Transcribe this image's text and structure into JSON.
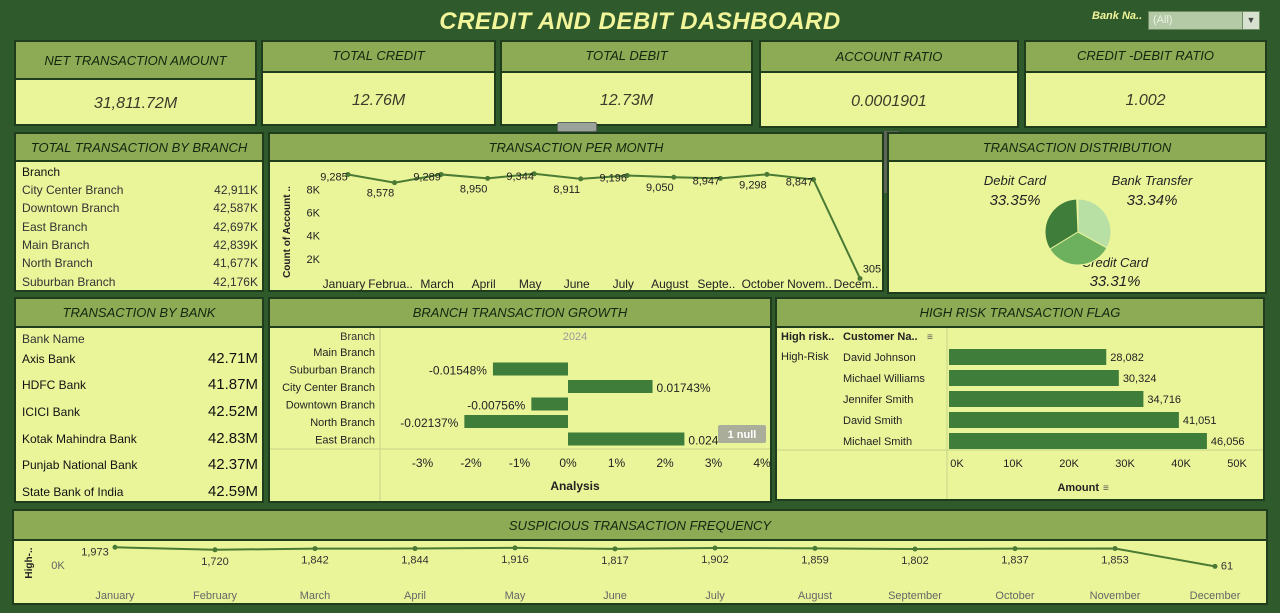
{
  "dashboard": {
    "title": "CREDIT AND DEBIT DASHBOARD"
  },
  "filter": {
    "label": "Bank Na..",
    "value": "(All)"
  },
  "kpis": [
    {
      "title": "NET TRANSACTION AMOUNT",
      "value": "31,811.72M"
    },
    {
      "title": "TOTAL CREDIT",
      "value": "12.76M"
    },
    {
      "title": "TOTAL DEBIT",
      "value": "12.73M"
    },
    {
      "title": "ACCOUNT RATIO",
      "value": "0.0001901"
    },
    {
      "title": "CREDIT -DEBIT RATIO",
      "value": "1.002"
    }
  ],
  "branch_panel": {
    "title": "TOTAL TRANSACTION BY BRANCH",
    "header": "Branch",
    "rows": [
      {
        "name": "City Center Branch",
        "value": "42,911K"
      },
      {
        "name": "Downtown Branch",
        "value": "42,587K"
      },
      {
        "name": "East Branch",
        "value": "42,697K"
      },
      {
        "name": "Main Branch",
        "value": "42,839K"
      },
      {
        "name": "North Branch",
        "value": "41,677K"
      },
      {
        "name": "Suburban Branch",
        "value": "42,176K"
      }
    ]
  },
  "bank_panel": {
    "title": "TRANSACTION BY BANK",
    "header": "Bank Name",
    "rows": [
      {
        "name": "Axis Bank",
        "value": "42.71M"
      },
      {
        "name": "HDFC Bank",
        "value": "41.87M"
      },
      {
        "name": "ICICI Bank",
        "value": "42.52M"
      },
      {
        "name": "Kotak Mahindra Bank",
        "value": "42.83M"
      },
      {
        "name": "Punjab National Bank",
        "value": "42.37M"
      },
      {
        "name": "State Bank of India",
        "value": "42.59M"
      }
    ]
  },
  "chart_data": [
    {
      "id": "monthly",
      "title": "TRANSACTION PER MONTH",
      "type": "line",
      "ylabel": "Count of Account ..",
      "categories": [
        "January",
        "Februa..",
        "March",
        "April",
        "May",
        "June",
        "July",
        "August",
        "Septe..",
        "October",
        "Novem..",
        "Decem.."
      ],
      "values": [
        9285,
        8578,
        9289,
        8950,
        9344,
        8911,
        9196,
        9050,
        8947,
        9298,
        8847,
        305
      ],
      "labels": [
        "9,285",
        "8,578",
        "9,289",
        "8,950",
        "9,344",
        "8,911",
        "9,196",
        "9,050",
        "8,947",
        "9,298",
        "8,847",
        "305"
      ],
      "yticks": [
        "2K",
        "4K",
        "6K",
        "8K"
      ],
      "ylim": [
        0,
        9500
      ],
      "color": "#4a7a34"
    },
    {
      "id": "distribution",
      "title": "TRANSACTION DISTRIBUTION",
      "type": "pie",
      "slices": [
        {
          "name": "Debit Card",
          "pct": "33.35%",
          "value": 33.35,
          "color": "#3f7d3a"
        },
        {
          "name": "Bank Transfer",
          "pct": "33.34%",
          "value": 33.34,
          "color": "#b9e0a4"
        },
        {
          "name": "Credit Card",
          "pct": "33.31%",
          "value": 33.31,
          "color": "#6db05d"
        }
      ]
    },
    {
      "id": "growth",
      "title": "BRANCH TRANSACTION GROWTH",
      "type": "bar",
      "header": "Branch",
      "column": "2024",
      "xlabel": "Analysis",
      "categories": [
        "Main Branch",
        "Suburban Branch",
        "City Center Branch",
        "Downtown Branch",
        "North Branch",
        "East Branch"
      ],
      "values": [
        null,
        -1.548,
        1.743,
        -0.756,
        -2.137,
        2.4
      ],
      "labels": [
        "",
        "-0.01548%",
        "0.01743%",
        "-0.00756%",
        "-0.02137%",
        "0.024"
      ],
      "xticks": [
        "-3%",
        "-2%",
        "-1%",
        "0%",
        "1%",
        "2%",
        "3%",
        "4%"
      ],
      "xlim": [
        -4,
        4
      ],
      "null_badge": "1 null",
      "color": "#3f7d3a"
    },
    {
      "id": "highrisk",
      "title": "HIGH RISK TRANSACTION FLAG",
      "type": "bar",
      "col1": "High risk..",
      "col2": "Customer Na..",
      "group": "High-Risk",
      "xlabel": "Amount",
      "categories": [
        "David Johnson",
        "Michael Williams",
        "Jennifer Smith",
        "David Smith",
        "Michael Smith"
      ],
      "values": [
        28082,
        30324,
        34716,
        41051,
        46056
      ],
      "labels": [
        "28,082",
        "30,324",
        "34,716",
        "41,051",
        "46,056"
      ],
      "xticks": [
        "0K",
        "10K",
        "20K",
        "30K",
        "40K",
        "50K"
      ],
      "xlim": [
        0,
        50000
      ],
      "color": "#3f7d3a"
    },
    {
      "id": "suspicious",
      "title": "SUSPICIOUS TRANSACTION FREQUENCY",
      "type": "line",
      "ylabel": "High-..",
      "ytick": "0K",
      "categories": [
        "January",
        "February",
        "March",
        "April",
        "May",
        "June",
        "July",
        "August",
        "September",
        "October",
        "November",
        "December"
      ],
      "values": [
        1973,
        1720,
        1842,
        1844,
        1916,
        1817,
        1902,
        1859,
        1802,
        1837,
        1853,
        61
      ],
      "labels": [
        "1,973",
        "1,720",
        "1,842",
        "1,844",
        "1,916",
        "1,817",
        "1,902",
        "1,859",
        "1,802",
        "1,837",
        "1,853",
        "61"
      ],
      "color": "#4a7a34"
    }
  ]
}
